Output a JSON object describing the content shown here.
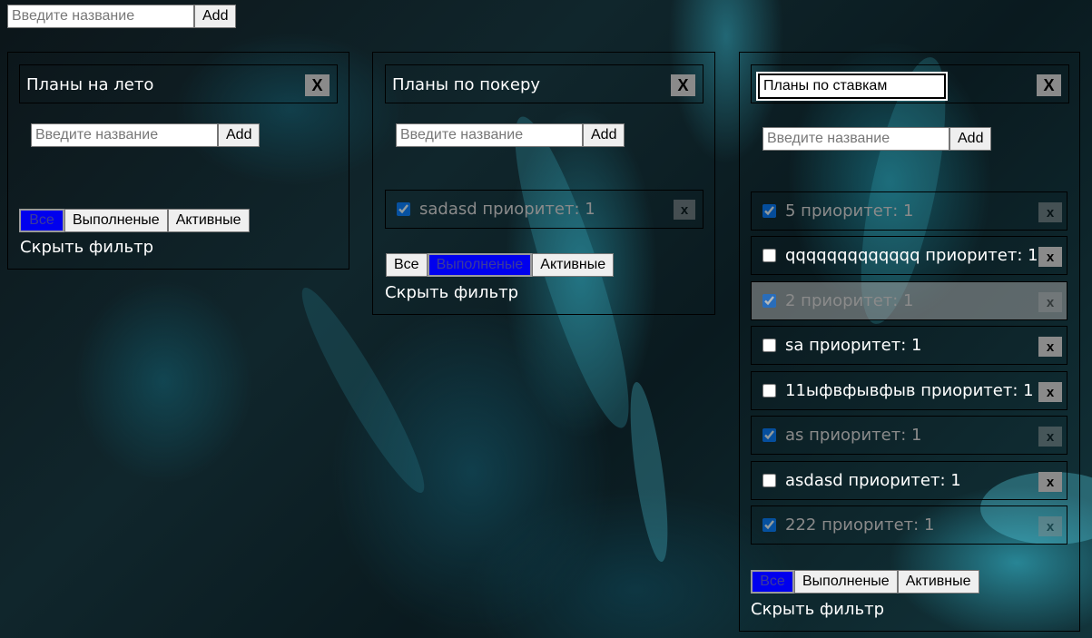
{
  "top": {
    "placeholder": "Введите название",
    "add_label": "Add"
  },
  "lists": [
    {
      "title": "Планы на лето",
      "close_label": "X",
      "add_placeholder": "Введите название",
      "add_label": "Add",
      "tasks": [],
      "filters": [
        "Все",
        "Выполненые",
        "Активные"
      ],
      "active_filter": 0,
      "hide_filter_label": "Скрыть фильтр"
    },
    {
      "title": "Планы по покеру",
      "close_label": "X",
      "add_placeholder": "Введите название",
      "add_label": "Add",
      "tasks": [
        {
          "text": "sadasd приоритет: 1",
          "done": true,
          "close_label": "x"
        }
      ],
      "filters": [
        "Все",
        "Выполненые",
        "Активные"
      ],
      "active_filter": 1,
      "hide_filter_label": "Скрыть фильтр"
    },
    {
      "title": "Планы по ставкам",
      "close_label": "X",
      "add_placeholder": "Введите название",
      "add_label": "Add",
      "tasks": [
        {
          "text": "5 приоритет: 1",
          "done": true,
          "close_label": "x"
        },
        {
          "text": "qqqqqqqqqqqqq приоритет: 1",
          "done": false,
          "close_label": "x"
        },
        {
          "text": "2 приоритет: 1",
          "done": true,
          "close_label": "x"
        },
        {
          "text": "sa приоритет: 1",
          "done": false,
          "close_label": "x"
        },
        {
          "text": "11ыфвфывфыв приоритет: 1",
          "done": false,
          "close_label": "x"
        },
        {
          "text": "as приоритет: 1",
          "done": true,
          "close_label": "x"
        },
        {
          "text": "asdasd приоритет: 1",
          "done": false,
          "close_label": "x"
        },
        {
          "text": "222 приоритет: 1",
          "done": true,
          "close_label": "x"
        }
      ],
      "filters": [
        "Все",
        "Выполненые",
        "Активные"
      ],
      "active_filter": 0,
      "hide_filter_label": "Скрыть фильтр"
    }
  ]
}
